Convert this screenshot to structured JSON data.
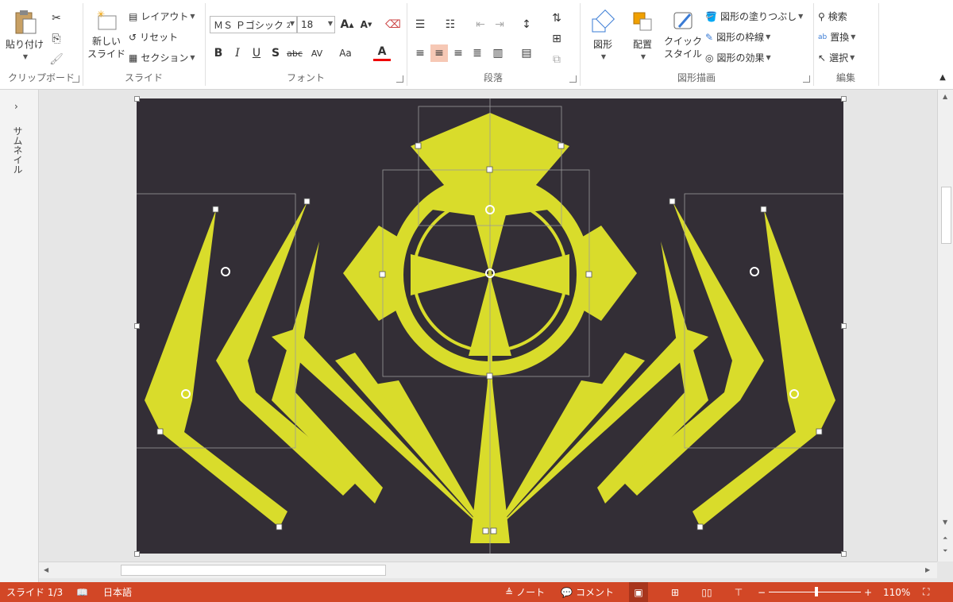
{
  "ribbon": {
    "clipboard": {
      "label": "クリップボード",
      "paste": "貼り付け"
    },
    "slides": {
      "label": "スライド",
      "new_slide_line1": "新しい",
      "new_slide_line2": "スライド",
      "layout": "レイアウト",
      "reset": "リセット",
      "section": "セクション"
    },
    "font": {
      "label": "フォント",
      "font_name": "ＭＳ Ｐゴシック 本",
      "font_size": "18"
    },
    "paragraph": {
      "label": "段落"
    },
    "drawing": {
      "label": "図形描画",
      "shapes": "図形",
      "arrange": "配置",
      "quick_styles_line1": "クイック",
      "quick_styles_line2": "スタイル",
      "shape_fill": "図形の塗りつぶし",
      "shape_outline": "図形の枠線",
      "shape_effects": "図形の効果"
    },
    "editing": {
      "label": "編集",
      "find": "検索",
      "replace": "置換",
      "select": "選択"
    }
  },
  "thumbnails": {
    "label": "サムネイル"
  },
  "statusbar": {
    "slide": "スライド 1/3",
    "language": "日本語",
    "notes": "ノート",
    "comments": "コメント",
    "zoom": "110%"
  },
  "colors": {
    "accent": "#d24726",
    "slide_bg": "#332e36",
    "shape_fill": "#d9dc2b"
  }
}
